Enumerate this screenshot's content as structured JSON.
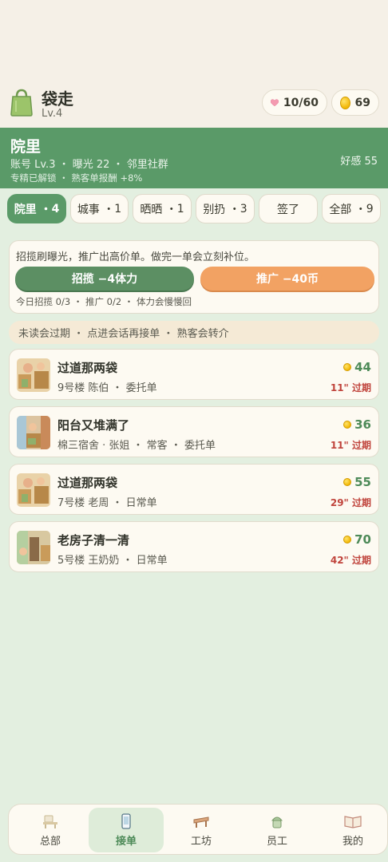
{
  "app": {
    "title": "袋走",
    "level": "Lv.4"
  },
  "stats": {
    "hearts": "10/60",
    "coins": "69"
  },
  "banner": {
    "title": "院里",
    "account_level": "账号 Lv.3",
    "exposure": "曝光 22",
    "community": "邻里社群",
    "unlock_note": "专精已解锁",
    "bonus_note": "熟客单报酬 +8%",
    "favor": "好感 55"
  },
  "tabs": [
    {
      "label": "院里",
      "count": "4"
    },
    {
      "label": "城事",
      "count": "1"
    },
    {
      "label": "晒晒",
      "count": "1"
    },
    {
      "label": "别扔",
      "count": "3"
    },
    {
      "label": "签了",
      "count": ""
    },
    {
      "label": "全部",
      "count": "9"
    }
  ],
  "promo": {
    "text": "招揽刷曝光，推广出高价单。做完一单会立刻补位。",
    "recruit_label": "招揽 −4体力",
    "promote_label": "推广 −40币",
    "recruit_today": "今日招揽 0/3",
    "promote_today": "推广 0/2",
    "stamina_note": "体力会慢慢回"
  },
  "info_bar": {
    "a": "未读会过期",
    "b": "点进会话再接单",
    "c": "熟客会转介"
  },
  "orders": [
    {
      "title": "过道那两袋",
      "meta": [
        "9号楼 陈伯",
        "委托单"
      ],
      "reward": "44",
      "deadline": "11\" 过期"
    },
    {
      "title": "阳台又堆满了",
      "meta": [
        "棉三宿舍 · 张姐",
        "常客",
        "委托单"
      ],
      "reward": "36",
      "deadline": "11\" 过期"
    },
    {
      "title": "过道那两袋",
      "meta": [
        "7号楼 老周",
        "日常单"
      ],
      "reward": "55",
      "deadline": "29\" 过期"
    },
    {
      "title": "老房子清一清",
      "meta": [
        "5号楼 王奶奶",
        "日常单"
      ],
      "reward": "70",
      "deadline": "42\" 过期"
    }
  ],
  "nav": [
    {
      "label": "总部",
      "icon": "desk-icon"
    },
    {
      "label": "接单",
      "icon": "phone-icon"
    },
    {
      "label": "工坊",
      "icon": "workbench-icon"
    },
    {
      "label": "员工",
      "icon": "worker-icon"
    },
    {
      "label": "我的",
      "icon": "book-icon"
    }
  ],
  "colors": {
    "brand_green": "#5a9a68",
    "promote_orange": "#f2a263",
    "deadline_red": "#c0443c"
  }
}
